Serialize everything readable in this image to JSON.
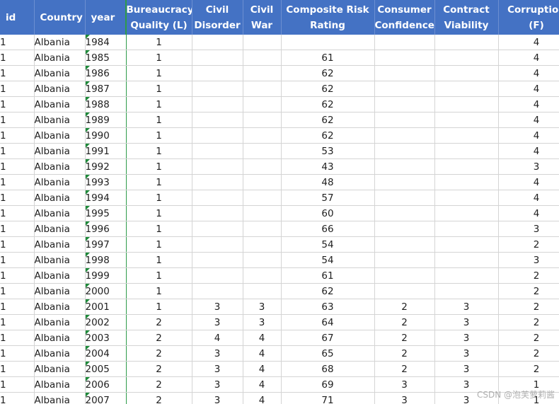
{
  "colors": {
    "header_bg": "#4472c4",
    "header_text": "#ffffff",
    "freeze_line": "#2e9b4a",
    "error_flag": "#1e8a3a",
    "gridline": "#d4d4d4"
  },
  "columns": [
    {
      "key": "id",
      "label": "id"
    },
    {
      "key": "country",
      "label": "Country"
    },
    {
      "key": "year",
      "label": "year"
    },
    {
      "key": "bq",
      "label": "Bureaucracy\nQuality (L)"
    },
    {
      "key": "cd",
      "label": "Civil\nDisorder"
    },
    {
      "key": "cw",
      "label": "Civil\nWar"
    },
    {
      "key": "crr",
      "label": "Composite Risk\nRating"
    },
    {
      "key": "cc",
      "label": "Consumer\nConfidence"
    },
    {
      "key": "cv",
      "label": "Contract\nViability"
    },
    {
      "key": "corr",
      "label": "Corruption\n(F)"
    }
  ],
  "rows": [
    [
      "1",
      "Albania",
      "1984",
      "1",
      "",
      "",
      "",
      "",
      "",
      "4"
    ],
    [
      "1",
      "Albania",
      "1985",
      "1",
      "",
      "",
      "61",
      "",
      "",
      "4"
    ],
    [
      "1",
      "Albania",
      "1986",
      "1",
      "",
      "",
      "62",
      "",
      "",
      "4"
    ],
    [
      "1",
      "Albania",
      "1987",
      "1",
      "",
      "",
      "62",
      "",
      "",
      "4"
    ],
    [
      "1",
      "Albania",
      "1988",
      "1",
      "",
      "",
      "62",
      "",
      "",
      "4"
    ],
    [
      "1",
      "Albania",
      "1989",
      "1",
      "",
      "",
      "62",
      "",
      "",
      "4"
    ],
    [
      "1",
      "Albania",
      "1990",
      "1",
      "",
      "",
      "62",
      "",
      "",
      "4"
    ],
    [
      "1",
      "Albania",
      "1991",
      "1",
      "",
      "",
      "53",
      "",
      "",
      "4"
    ],
    [
      "1",
      "Albania",
      "1992",
      "1",
      "",
      "",
      "43",
      "",
      "",
      "3"
    ],
    [
      "1",
      "Albania",
      "1993",
      "1",
      "",
      "",
      "48",
      "",
      "",
      "4"
    ],
    [
      "1",
      "Albania",
      "1994",
      "1",
      "",
      "",
      "57",
      "",
      "",
      "4"
    ],
    [
      "1",
      "Albania",
      "1995",
      "1",
      "",
      "",
      "60",
      "",
      "",
      "4"
    ],
    [
      "1",
      "Albania",
      "1996",
      "1",
      "",
      "",
      "66",
      "",
      "",
      "3"
    ],
    [
      "1",
      "Albania",
      "1997",
      "1",
      "",
      "",
      "54",
      "",
      "",
      "2"
    ],
    [
      "1",
      "Albania",
      "1998",
      "1",
      "",
      "",
      "54",
      "",
      "",
      "3"
    ],
    [
      "1",
      "Albania",
      "1999",
      "1",
      "",
      "",
      "61",
      "",
      "",
      "2"
    ],
    [
      "1",
      "Albania",
      "2000",
      "1",
      "",
      "",
      "62",
      "",
      "",
      "2"
    ],
    [
      "1",
      "Albania",
      "2001",
      "1",
      "3",
      "3",
      "63",
      "2",
      "3",
      "2"
    ],
    [
      "1",
      "Albania",
      "2002",
      "2",
      "3",
      "3",
      "64",
      "2",
      "3",
      "2"
    ],
    [
      "1",
      "Albania",
      "2003",
      "2",
      "4",
      "4",
      "67",
      "2",
      "3",
      "2"
    ],
    [
      "1",
      "Albania",
      "2004",
      "2",
      "3",
      "4",
      "65",
      "2",
      "3",
      "2"
    ],
    [
      "1",
      "Albania",
      "2005",
      "2",
      "3",
      "4",
      "68",
      "2",
      "3",
      "2"
    ],
    [
      "1",
      "Albania",
      "2006",
      "2",
      "3",
      "4",
      "69",
      "3",
      "3",
      "1"
    ],
    [
      "1",
      "Albania",
      "2007",
      "2",
      "3",
      "4",
      "71",
      "3",
      "3",
      "1"
    ]
  ],
  "watermark": "CSDN @泡芙萝莉酱"
}
